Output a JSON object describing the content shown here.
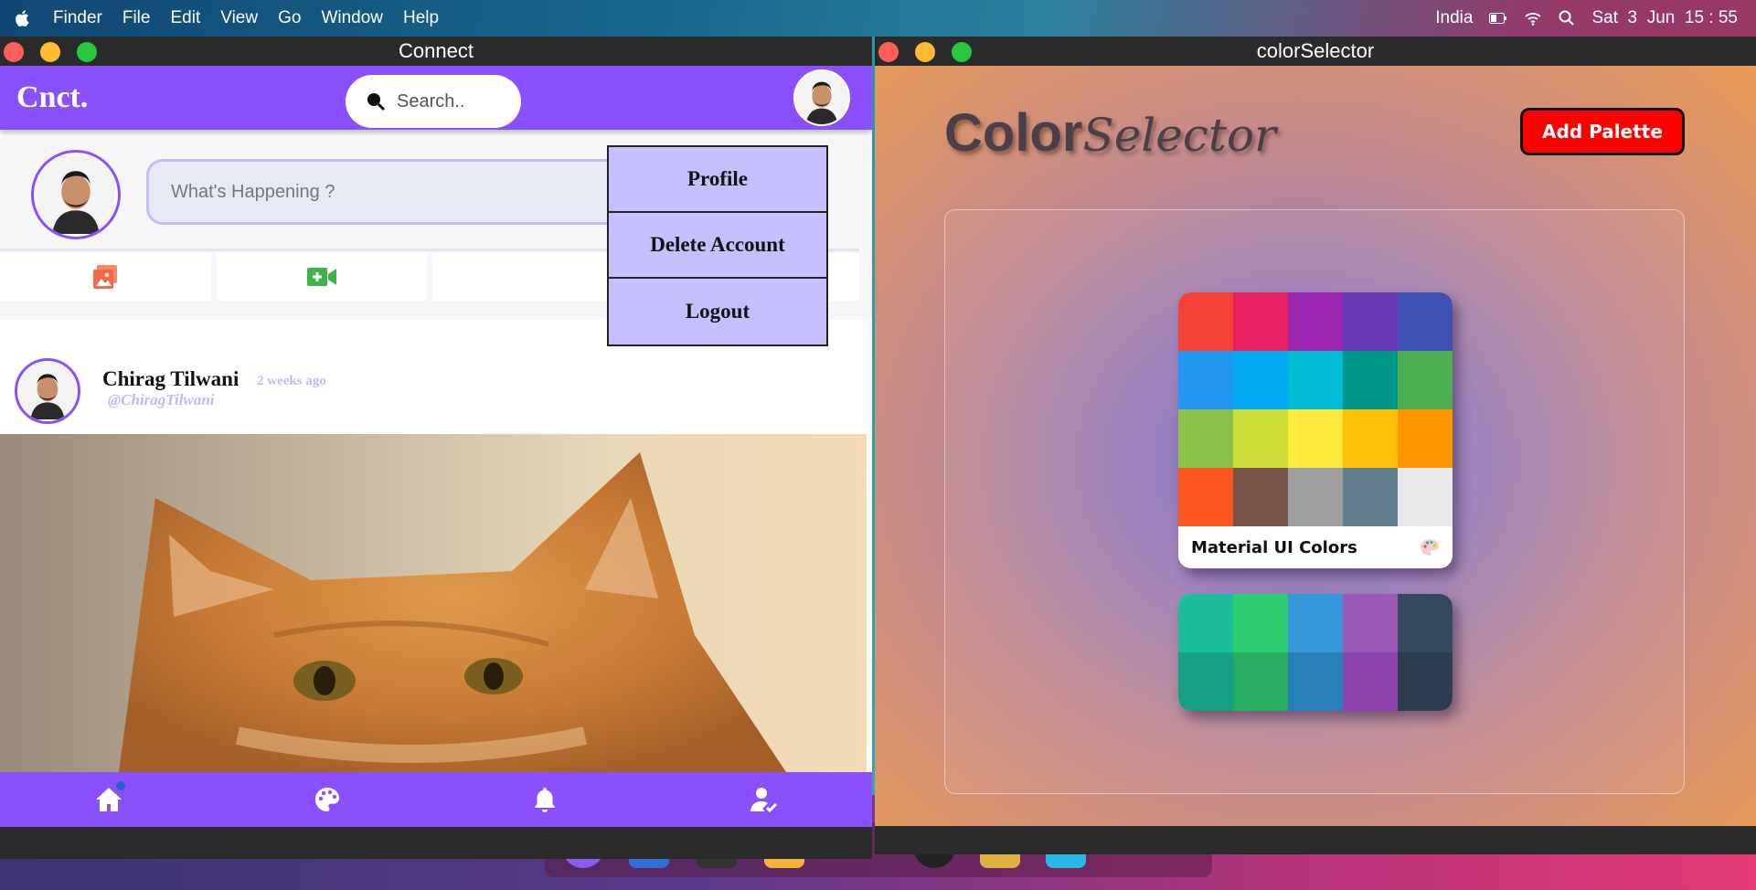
{
  "menubar": {
    "items": [
      "Finder",
      "File",
      "Edit",
      "View",
      "Go",
      "Window",
      "Help"
    ],
    "right": {
      "region": "India",
      "day": "Sat",
      "date": "3",
      "month": "Jun",
      "time": "15 : 55"
    }
  },
  "connect": {
    "window_title": "Connect",
    "logo": "Cnct.",
    "search_placeholder": "Search..",
    "composer_placeholder": "What's Happening ?",
    "dropdown": [
      "Profile",
      "Delete Account",
      "Logout"
    ],
    "post": {
      "name": "Chirag Tilwani",
      "time": "2 weeks ago",
      "handle": "@ChiragTilwani"
    },
    "accent": "#8950fc"
  },
  "colorsel": {
    "window_title": "colorSelector",
    "title_part1": "Color",
    "title_part2": "Selector",
    "add_button": "Add Palette",
    "palettes": [
      {
        "name": "Material UI Colors",
        "colors": [
          "#f44336",
          "#e91e63",
          "#9c27b0",
          "#673ab7",
          "#3f51b5",
          "#2196f3",
          "#03a9f4",
          "#00bcd4",
          "#009688",
          "#4caf50",
          "#8bc34a",
          "#cddc39",
          "#ffeb3b",
          "#ffc107",
          "#ff9800",
          "#ff5722",
          "#795548",
          "#9e9e9e",
          "#607d8b",
          "#e8e8e8"
        ]
      },
      {
        "name": "",
        "colors": [
          "#1abc9c",
          "#2ecc71",
          "#3498db",
          "#9b59b6",
          "#34495e",
          "#16a085",
          "#27ae60",
          "#2980b9",
          "#8e44ad",
          "#2c3e50"
        ]
      }
    ]
  }
}
